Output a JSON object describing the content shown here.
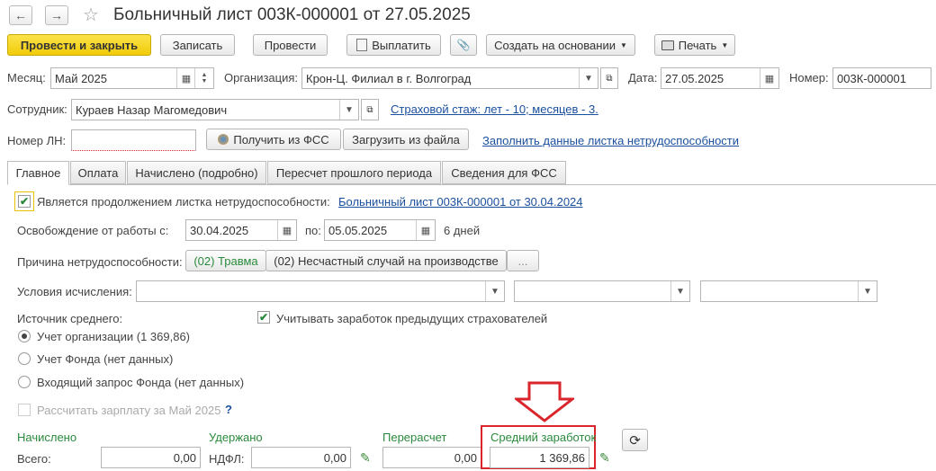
{
  "window": {
    "title": "Больничный лист 003К-000001 от 27.05.2025",
    "back_icon": "←",
    "forward_icon": "→",
    "star_icon": "☆"
  },
  "toolbar": {
    "post_close": "Провести и закрыть",
    "save": "Записать",
    "post": "Провести",
    "pay": "Выплатить",
    "attach_icon": "📎",
    "create_based": "Создать на основании",
    "print": "Печать"
  },
  "header": {
    "month_label": "Месяц:",
    "month_value": "Май 2025",
    "org_label": "Организация:",
    "org_value": "Крон-Ц. Филиал в г. Волгоград",
    "date_label": "Дата:",
    "date_value": "27.05.2025",
    "number_label": "Номер:",
    "number_value": "003К-000001",
    "employee_label": "Сотрудник:",
    "employee_value": "Кураев Назар Магомедович",
    "insurance_link": "Страховой стаж: лет - 10; месяцев - 3.",
    "ln_label": "Номер ЛН:",
    "ln_value": "",
    "get_fss": "Получить из ФСС",
    "load_file": "Загрузить из файла",
    "fill_link": "Заполнить данные листка нетрудоспособности"
  },
  "tabs": [
    {
      "label": "Главное"
    },
    {
      "label": "Оплата"
    },
    {
      "label": "Начислено (подробно)"
    },
    {
      "label": "Пересчет прошлого периода"
    },
    {
      "label": "Сведения для ФСС"
    }
  ],
  "main": {
    "continuation_label": "Является продолжением листка нетрудоспособности:",
    "continuation_checked": true,
    "continuation_link": "Больничный лист 003К-000001 от 30.04.2024",
    "release_label": "Освобождение от работы с:",
    "release_from": "30.04.2025",
    "release_to_label": "по:",
    "release_to": "05.05.2025",
    "days": "6 дней",
    "cause_label": "Причина нетрудоспособности:",
    "cause_code": "(02) Травма",
    "cause_detail": "(02) Несчастный случай на производстве",
    "cause_more": "...",
    "conditions_label": "Условия исчисления:",
    "source_label": "Источник среднего:",
    "consider_prev": "Учитывать заработок предыдущих страхователей",
    "consider_prev_checked": true,
    "radio_options": [
      {
        "label": "Учет организации (1 369,86)",
        "selected": true
      },
      {
        "label": "Учет Фонда (нет данных)",
        "selected": false
      },
      {
        "label": "Входящий запрос Фонда (нет данных)",
        "selected": false
      }
    ],
    "calc_salary": "Рассчитать зарплату за Май 2025",
    "calc_help": "?"
  },
  "totals": {
    "accrued_label": "Начислено",
    "total_label": "Всего:",
    "total_value": "0,00",
    "withheld_label": "Удержано",
    "ndfl_label": "НДФЛ:",
    "ndfl_value": "0,00",
    "recalc_label": "Перерасчет",
    "recalc_value": "0,00",
    "avg_label": "Средний заработок",
    "avg_value": "1 369,86",
    "refresh_icon": "⟳"
  },
  "colors": {
    "accent_yellow": "#f5d31c",
    "highlight_red": "#d9252b",
    "green": "#2a8a3c",
    "link_blue": "#1a4f9e"
  }
}
